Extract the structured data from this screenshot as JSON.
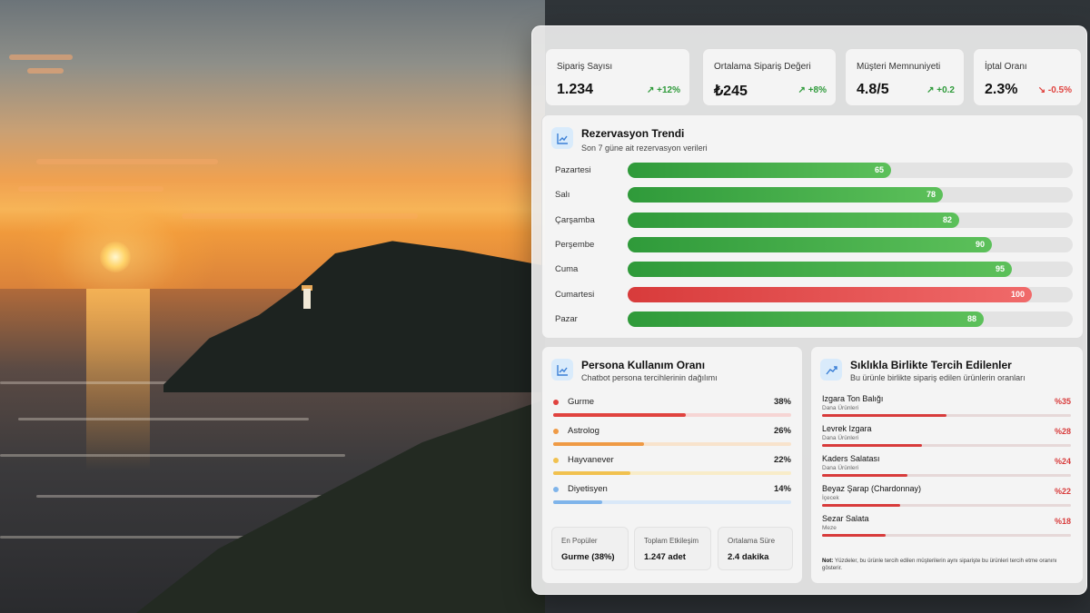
{
  "kpis": [
    {
      "label": "Sipariş Sayısı",
      "value": "1.234",
      "delta": "+12%",
      "trend": "up"
    },
    {
      "label": "Ortalama Sipariş Değeri",
      "value": "₺245",
      "delta": "+8%",
      "trend": "up"
    },
    {
      "label": "Müşteri Memnuniyeti",
      "value": "4.8/5",
      "delta": "+0.2",
      "trend": "up"
    },
    {
      "label": "İptal Oranı",
      "value": "2.3%",
      "delta": "-0.5%",
      "trend": "down"
    }
  ],
  "trend": {
    "title": "Rezervasyon Trendi",
    "subtitle": "Son 7 güne ait rezervasyon verileri",
    "max": 110,
    "days": [
      {
        "label": "Pazartesi",
        "value": 65
      },
      {
        "label": "Salı",
        "value": 78
      },
      {
        "label": "Çarşamba",
        "value": 82
      },
      {
        "label": "Perşembe",
        "value": 90
      },
      {
        "label": "Cuma",
        "value": 95
      },
      {
        "label": "Cumartesi",
        "value": 100,
        "peak": true
      },
      {
        "label": "Pazar",
        "value": 88
      }
    ]
  },
  "persona": {
    "title": "Persona Kullanım Oranı",
    "subtitle": "Chatbot persona tercihlerinin dağılımı",
    "items": [
      {
        "name": "Gurme",
        "pct": "38%",
        "value": 38,
        "color": "#e0433f",
        "track": "#f6d5d4"
      },
      {
        "name": "Astrolog",
        "pct": "26%",
        "value": 26,
        "color": "#ef9a45",
        "track": "#f8e3cc"
      },
      {
        "name": "Hayvanever",
        "pct": "22%",
        "value": 22,
        "color": "#f1c14f",
        "track": "#f8ecc9"
      },
      {
        "name": "Diyetisyen",
        "pct": "14%",
        "value": 14,
        "color": "#7fb4ea",
        "track": "#d9e8f8"
      }
    ],
    "stats": [
      {
        "label": "En Popüler",
        "value": "Gurme (38%)"
      },
      {
        "label": "Toplam Etkileşim",
        "value": "1.247 adet"
      },
      {
        "label": "Ortalama Süre",
        "value": "2.4 dakika"
      }
    ]
  },
  "paired": {
    "title": "Sıklıkla Birlikte Tercih Edilenler",
    "subtitle": "Bu ürünle birlikte sipariş edilen ürünlerin oranları",
    "items": [
      {
        "name": "Izgara Ton Balığı",
        "category": "Dana Ürünleri",
        "pct": "%35",
        "value": 35
      },
      {
        "name": "Levrek Izgara",
        "category": "Dana Ürünleri",
        "pct": "%28",
        "value": 28
      },
      {
        "name": "Kaders Salatası",
        "category": "Dana Ürünleri",
        "pct": "%24",
        "value": 24
      },
      {
        "name": "Beyaz Şarap (Chardonnay)",
        "category": "İçecek",
        "pct": "%22",
        "value": 22
      },
      {
        "name": "Sezar Salata",
        "category": "Meze",
        "pct": "%18",
        "value": 18
      }
    ],
    "max": 70,
    "note_label": "Not:",
    "note_text": "Yüzdeler, bu ürünle tercih edilen müşterilerin aynı siparişte bu ürünleri tercih etme oranını gösterir."
  },
  "icons": {
    "chart": "bar-chart-icon",
    "trend": "trend-up-icon"
  }
}
